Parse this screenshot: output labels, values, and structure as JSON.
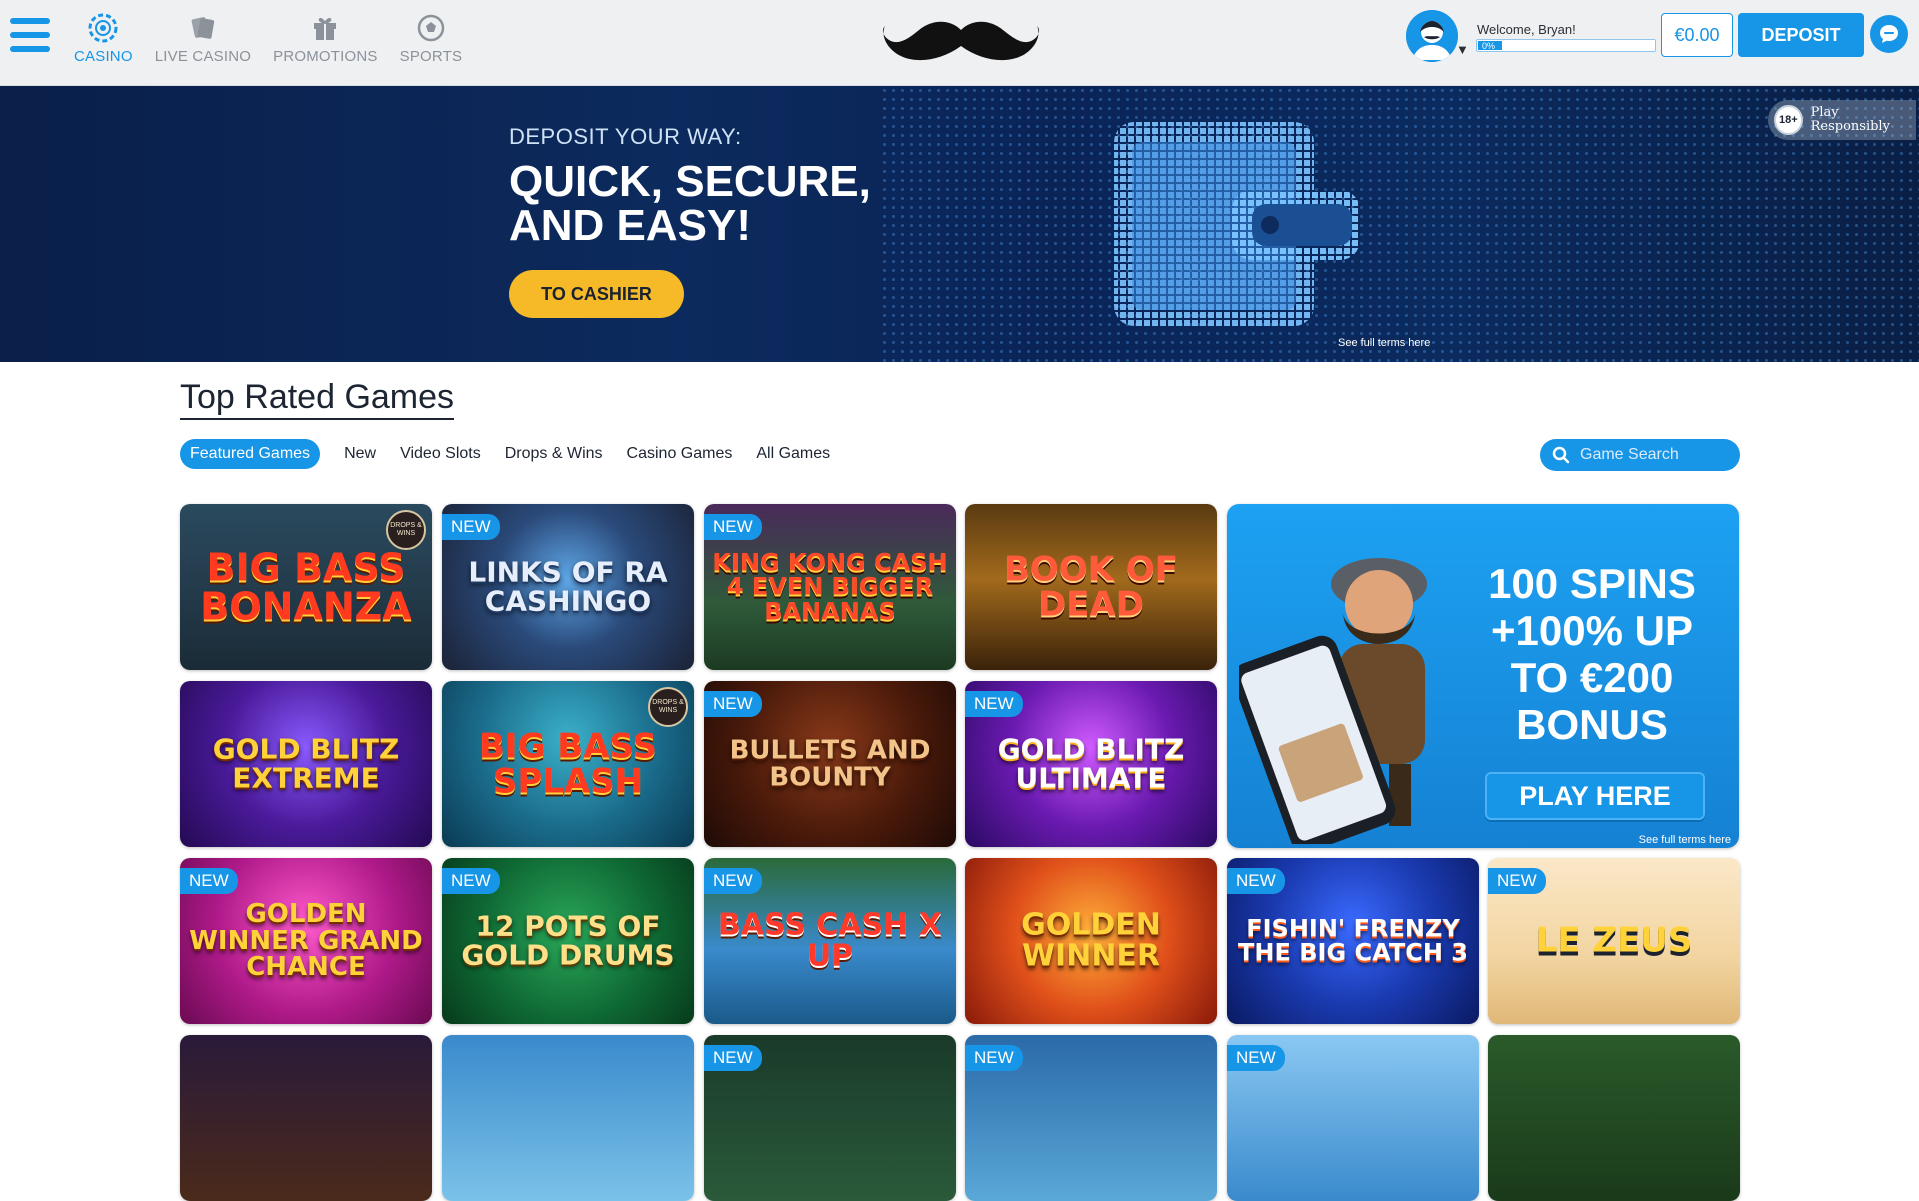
{
  "header": {
    "nav": [
      {
        "label": "CASINO",
        "icon": "casino-chip-icon",
        "active": true
      },
      {
        "label": "LIVE CASINO",
        "icon": "live-cards-icon",
        "active": false
      },
      {
        "label": "PROMOTIONS",
        "icon": "gift-box-icon",
        "active": false
      },
      {
        "label": "SPORTS",
        "icon": "soccer-ball-icon",
        "active": false
      }
    ],
    "logo": "mustache-logo",
    "welcome": "Welcome, Bryan!",
    "progress_label": "0%",
    "progress_value": 0,
    "balance": "€0.00",
    "deposit_label": "DEPOSIT",
    "chat_icon": "chat-bubble-icon"
  },
  "hero": {
    "eyebrow": "DEPOSIT YOUR WAY:",
    "title": "QUICK, SECURE, AND EASY!",
    "button": "TO CASHIER",
    "terms": "See full terms here",
    "age_badge": "18+",
    "responsibly": "Play Responsibly"
  },
  "games": {
    "title": "Top Rated Games",
    "filters": [
      "Featured Games",
      "New",
      "Video Slots",
      "Drops & Wins",
      "Casino Games",
      "All Games"
    ],
    "active_filter": "Featured Games",
    "search_placeholder": "Game Search",
    "new_label": "NEW",
    "drops_label": "DROPS & WINS",
    "tiles": [
      {
        "name": "BIG BASS BONANZA",
        "new": false,
        "drops": true
      },
      {
        "name": "LINKS OF RA CASHINGO",
        "new": true,
        "drops": false
      },
      {
        "name": "KING KONG CASH 4 EVEN BIGGER BANANAS",
        "new": true,
        "drops": false
      },
      {
        "name": "BOOK OF DEAD",
        "new": false,
        "drops": false
      },
      {
        "name": "GOLD BLITZ EXTREME",
        "new": false,
        "drops": false
      },
      {
        "name": "BIG BASS SPLASH",
        "new": false,
        "drops": true
      },
      {
        "name": "BULLETS AND BOUNTY",
        "new": true,
        "drops": false
      },
      {
        "name": "GOLD BLITZ ULTIMATE",
        "new": true,
        "drops": false
      },
      {
        "name": "GOLDEN WINNER GRAND CHANCE",
        "new": true,
        "drops": false
      },
      {
        "name": "12 POTS OF GOLD DRUMS",
        "new": true,
        "drops": false
      },
      {
        "name": "BASS CASH X UP",
        "new": true,
        "drops": false
      },
      {
        "name": "GOLDEN WINNER",
        "new": false,
        "drops": false
      },
      {
        "name": "FISHIN' FRENZY THE BIG CATCH 3",
        "new": true,
        "drops": false
      },
      {
        "name": "LE ZEUS",
        "new": true,
        "drops": false
      }
    ],
    "promo": {
      "text": "100 SPINS +100% UP TO €200 BONUS",
      "button": "PLAY HERE",
      "terms": "See full terms here"
    }
  }
}
